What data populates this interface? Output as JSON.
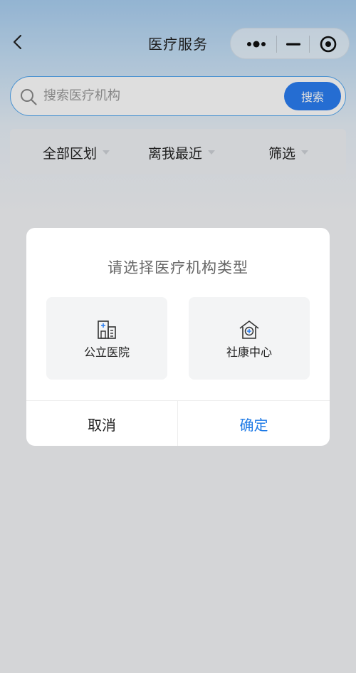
{
  "header": {
    "title": "医疗服务"
  },
  "search": {
    "placeholder": "搜索医疗机构",
    "button": "搜索"
  },
  "filters": {
    "region": "全部区划",
    "distance": "离我最近",
    "filter": "筛选"
  },
  "dialog": {
    "title": "请选择医疗机构类型",
    "options": [
      {
        "label": "公立医院",
        "icon": "hospital-building-icon"
      },
      {
        "label": "社康中心",
        "icon": "community-health-house-icon"
      }
    ],
    "cancel": "取消",
    "confirm": "确定"
  },
  "colors": {
    "accent": "#2b7ef2",
    "confirm": "#1e7ae6"
  }
}
